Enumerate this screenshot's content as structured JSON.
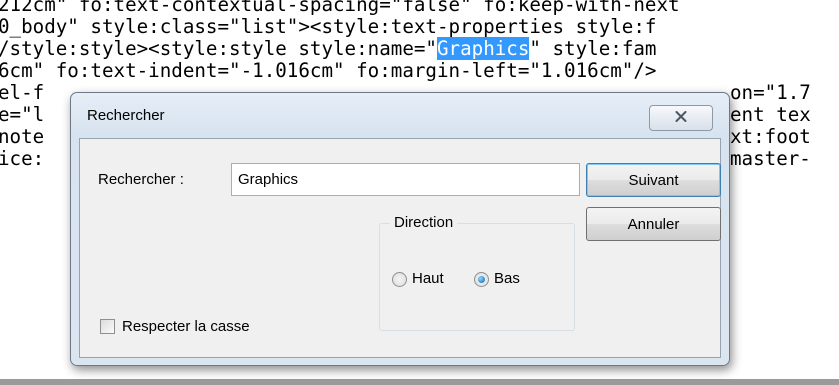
{
  "editor": {
    "lines": [
      {
        "pre": "212cm\" fo:text-contextual-spacing=\"false\" fo:keep-with-next",
        "hl": "",
        "post": ""
      },
      {
        "pre": "0_body\" style:class=\"list\"><style:text-properties style:f",
        "hl": "",
        "post": ""
      },
      {
        "pre": "/style:style><style:style style:name=\"",
        "hl": "Graphics",
        "post": "\" style:fam"
      },
      {
        "pre": "6cm\" fo:text-indent=\"-1.016cm\" fo:margin-left=\"1.016cm\"/>",
        "hl": "",
        "post": ""
      }
    ],
    "partial_left": [
      "el-f",
      "e=\"l",
      "note",
      "ice:"
    ],
    "partial_right": [
      "on=\"1.7",
      "ent tex",
      "xt:foot",
      "master-"
    ]
  },
  "dialog": {
    "title": "Rechercher",
    "close_icon": "close-x-icon",
    "find_label": "Rechercher :",
    "find_value": "Graphics",
    "next_button": "Suivant",
    "cancel_button": "Annuler",
    "direction_label": "Direction",
    "up_label": "Haut",
    "down_label": "Bas",
    "selected_direction": "Bas",
    "match_case_label": "Respecter la casse",
    "match_case_checked": false
  }
}
